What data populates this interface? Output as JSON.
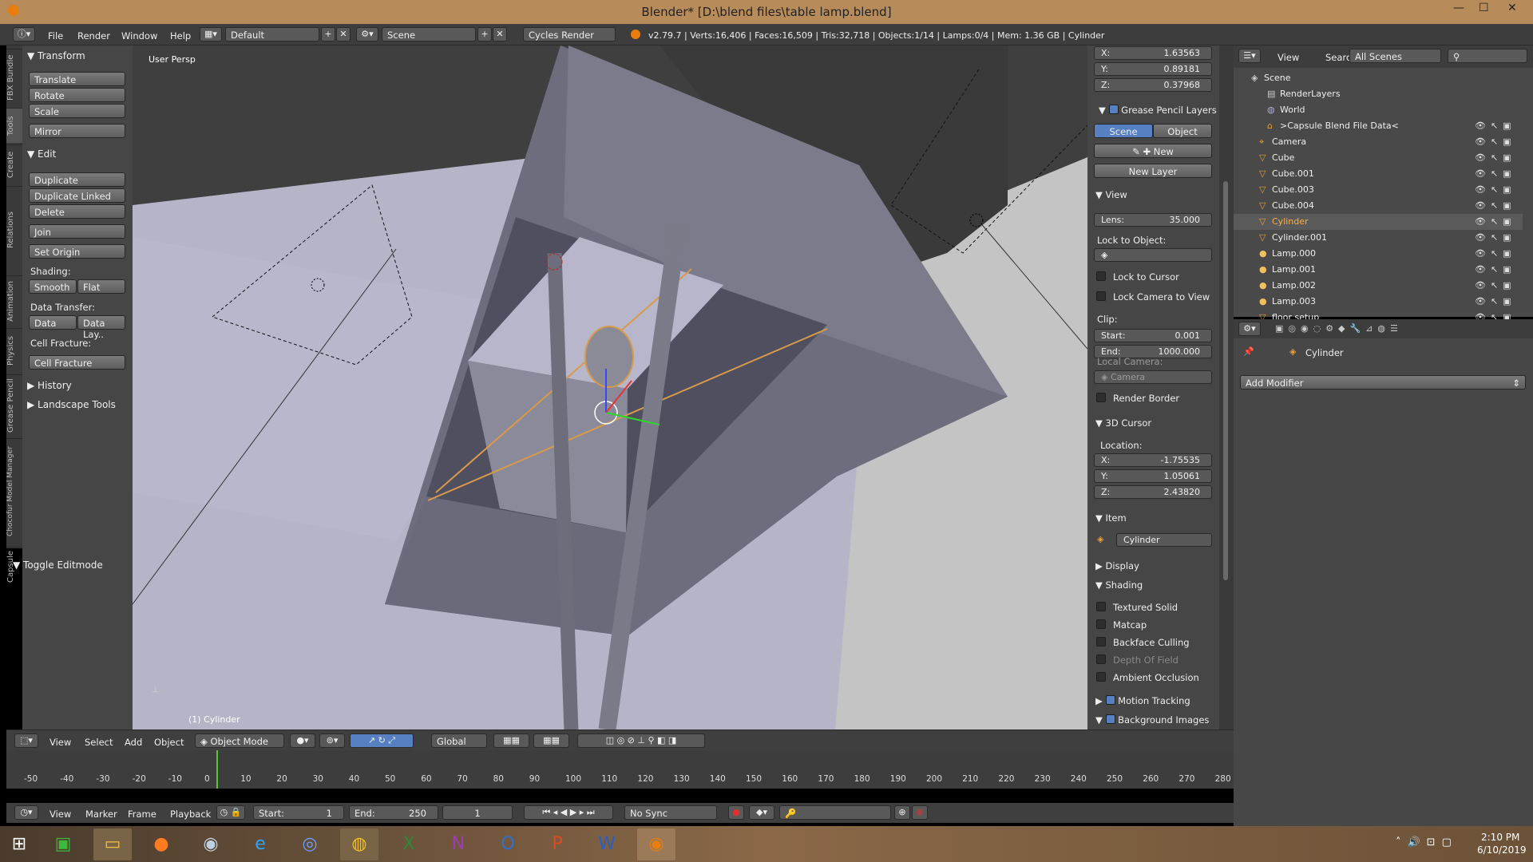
{
  "window": {
    "title": "Blender* [D:\\blend files\\table lamp.blend]"
  },
  "info_header": {
    "menus": [
      "File",
      "Render",
      "Window",
      "Help"
    ],
    "layout": "Default",
    "scene": "Scene",
    "engine": "Cycles Render",
    "stats": "v2.79.7 | Verts:16,406 | Faces:16,509 | Tris:32,718 | Objects:1/14 | Lamps:0/4 | Mem: 1.36 GB | Cylinder"
  },
  "tool_tabs": [
    "FBX Bundle",
    "Tools",
    "Create",
    "Relations",
    "Animation",
    "Physics",
    "Grease Pencil",
    "Chocofur Model Manager",
    "Capsule"
  ],
  "toolshelf": {
    "transform": {
      "title": "Transform",
      "buttons": [
        "Translate",
        "Rotate",
        "Scale",
        "Mirror"
      ]
    },
    "edit": {
      "title": "Edit",
      "buttons": [
        "Duplicate",
        "Duplicate Linked",
        "Delete",
        "Join",
        "Set Origin"
      ],
      "shading_label": "Shading:",
      "smooth": "Smooth",
      "flat": "Flat",
      "data_transfer_label": "Data Transfer:",
      "data": "Data",
      "data_layers": "Data Lay..",
      "cell_fracture_label": "Cell Fracture:",
      "cell_fracture": "Cell Fracture"
    },
    "history": "History",
    "landscape": "Landscape Tools",
    "toggle": "Toggle Editmode"
  },
  "viewport": {
    "view_name": "User Persp",
    "object_label": "(1) Cylinder"
  },
  "n_panel": {
    "x": "1.63563",
    "y": "0.89181",
    "z": "0.37968",
    "grease_pencil_title": "Grease Pencil Layers",
    "scene_tab": "Scene",
    "object_tab": "Object",
    "new": "New",
    "new_layer": "New Layer",
    "view_title": "View",
    "lens_label": "Lens:",
    "lens": "35.000",
    "lock_to_object": "Lock to Object:",
    "lock_to_cursor": "Lock to Cursor",
    "lock_camera": "Lock Camera to View",
    "clip_label": "Clip:",
    "clip_start_label": "Start:",
    "clip_start": "0.001",
    "clip_end_label": "End:",
    "clip_end": "1000.000",
    "local_camera": "Local Camera:",
    "camera": "Camera",
    "render_border": "Render Border",
    "cursor_title": "3D Cursor",
    "location_label": "Location:",
    "cx": "-1.75535",
    "cy": "1.05061",
    "cz": "2.43820",
    "item_title": "Item",
    "item_name": "Cylinder",
    "display_title": "Display",
    "shading_title": "Shading",
    "textured_solid": "Textured Solid",
    "matcap": "Matcap",
    "backface": "Backface Culling",
    "dof": "Depth Of Field",
    "ao": "Ambient Occlusion",
    "motion_tracking": "Motion Tracking",
    "background_images": "Background Images"
  },
  "outliner": {
    "view": "View",
    "search": "Search",
    "filter": "All Scenes",
    "items": [
      "Scene",
      "RenderLayers",
      "World",
      ">Capsule Blend File Data<",
      "Camera",
      "Cube",
      "Cube.001",
      "Cube.003",
      "Cube.004",
      "Cylinder",
      "Cylinder.001",
      "Lamp.000",
      "Lamp.001",
      "Lamp.002",
      "Lamp.003",
      "floor setup"
    ]
  },
  "properties": {
    "object": "Cylinder",
    "add_modifier": "Add Modifier"
  },
  "view3d_header": {
    "menus": [
      "View",
      "Select",
      "Add",
      "Object"
    ],
    "mode": "Object Mode",
    "orientation": "Global"
  },
  "timeline": {
    "ticks": [
      "-50",
      "-40",
      "-30",
      "-20",
      "-10",
      "0",
      "10",
      "20",
      "30",
      "40",
      "50",
      "60",
      "70",
      "80",
      "90",
      "100",
      "110",
      "120",
      "130",
      "140",
      "150",
      "160",
      "170",
      "180",
      "190",
      "200",
      "210",
      "220",
      "230",
      "240",
      "250",
      "260",
      "270",
      "280"
    ],
    "menus": [
      "View",
      "Marker",
      "Frame",
      "Playback"
    ],
    "start_label": "Start:",
    "start": "1",
    "end_label": "End:",
    "end": "250",
    "current": "1",
    "sync": "No Sync"
  },
  "taskbar": {
    "time": "2:10 PM",
    "date": "6/10/2019"
  }
}
